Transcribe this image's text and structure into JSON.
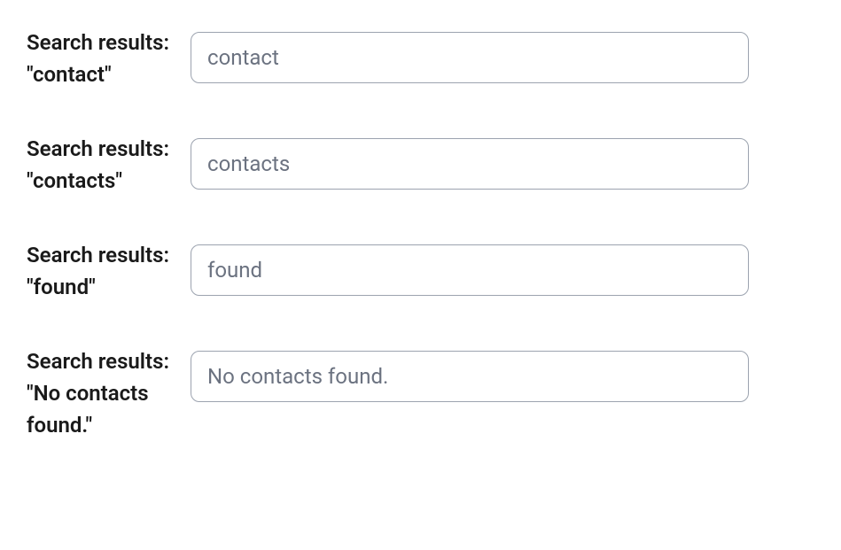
{
  "rows": [
    {
      "label": "Search results: \"contact\"",
      "value": "contact"
    },
    {
      "label": "Search results: \"contacts\"",
      "value": "contacts"
    },
    {
      "label": "Search results: \"found\"",
      "value": "found"
    },
    {
      "label": "Search results: \"No contacts found.\"",
      "value": "No contacts found."
    }
  ]
}
